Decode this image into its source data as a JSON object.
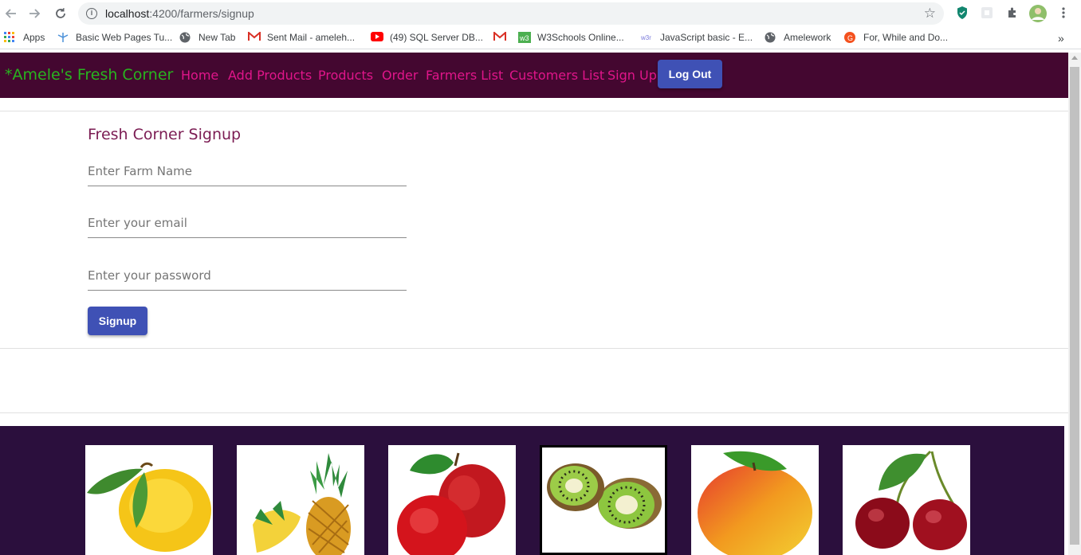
{
  "browser": {
    "url_host": "localhost",
    "url_path": ":4200/farmers/signup",
    "bookmarks": [
      {
        "label": "Apps",
        "icon": "apps-grid-icon"
      },
      {
        "label": "Basic Web Pages Tu...",
        "icon": "bookmark-icon"
      },
      {
        "label": "New Tab",
        "icon": "globe-icon"
      },
      {
        "label": "Sent Mail - ameleh...",
        "icon": "gmail-icon"
      },
      {
        "label": "(49) SQL Server DB...",
        "icon": "youtube-icon"
      },
      {
        "label": "",
        "icon": "gmail-icon"
      },
      {
        "label": "W3Schools Online...",
        "icon": "w3schools-icon"
      },
      {
        "label": "JavaScript basic - E...",
        "icon": "w3resource-icon"
      },
      {
        "label": "Amelework",
        "icon": "globe-icon"
      },
      {
        "label": "For, While and Do...",
        "icon": "g-icon"
      }
    ],
    "more_bookmarks": "»"
  },
  "navbar": {
    "brand": "*Amele's Fresh Corner",
    "links": [
      "Home",
      "Add Products",
      "Products",
      "Order",
      "Farmers List",
      "Customers List",
      "Sign Up"
    ],
    "logout_label": "Log Out"
  },
  "form": {
    "title": "Fresh Corner Signup",
    "farm_name_placeholder": "Enter Farm Name",
    "email_placeholder": "Enter your email",
    "password_placeholder": "Enter your password",
    "submit_label": "Signup"
  },
  "footer": {
    "fruits": [
      "lemon-image",
      "pineapple-image",
      "apple-image",
      "kiwi-image",
      "mango-image",
      "cherry-image"
    ]
  },
  "colors": {
    "navbar_bg": "#440730",
    "brand": "#28b41f",
    "nav_link": "#e0158a",
    "button": "#3f51b5",
    "title": "#7b1c53",
    "footer_bg": "#2b0f3d"
  }
}
